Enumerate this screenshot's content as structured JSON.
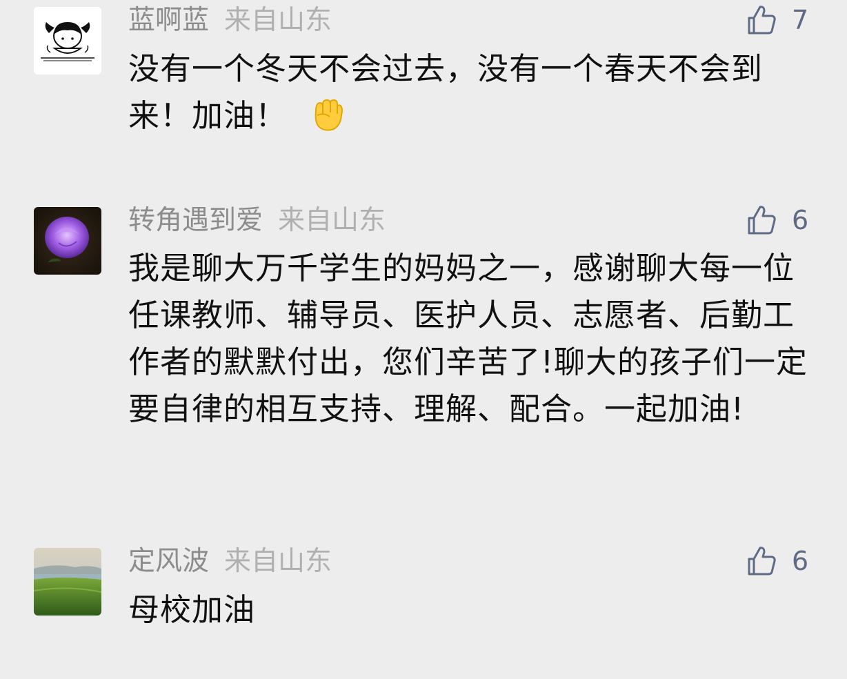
{
  "comments": [
    {
      "username": "蓝啊蓝",
      "location": "来自山东",
      "likes": "7",
      "text": "没有一个冬天不会过去，没有一个春天不会到来！加油！",
      "emoji": "raised-fist-icon"
    },
    {
      "username": "转角遇到爱",
      "location": "来自山东",
      "likes": "6",
      "text": "我是聊大万千学生的妈妈之一，感谢聊大每一位任课教师、辅导员、医护人员、志愿者、后勤工作者的默默付出，您们辛苦了!聊大的孩子们一定要自律的相互支持、理解、配合。一起加油!"
    },
    {
      "username": "定风波",
      "location": "来自山东",
      "likes": "6",
      "text": "母校加油"
    }
  ],
  "colors": {
    "background": "#ededed",
    "username": "#8c8c8c",
    "location": "#b0b0b0",
    "text": "#111111",
    "like_icon": "#5f6b85"
  }
}
